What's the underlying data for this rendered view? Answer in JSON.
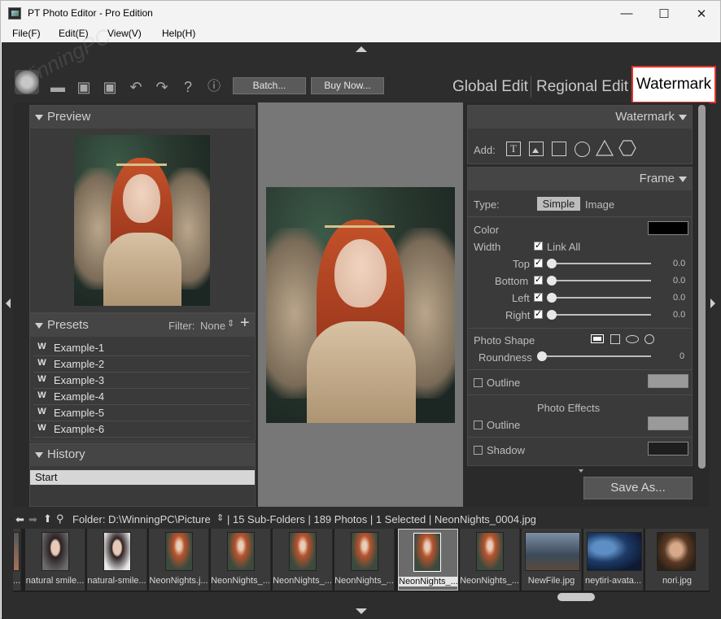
{
  "window": {
    "title": "PT Photo Editor - Pro Edition",
    "minimize": "—",
    "maximize": "☐",
    "close": "✕"
  },
  "menu": [
    "File(F)",
    "Edit(E)",
    "View(V)",
    "Help(H)"
  ],
  "toolbar": {
    "batch_label": "Batch...",
    "buy_label": "Buy Now..."
  },
  "mode_tabs": {
    "global": "Global Edit",
    "regional": "Regional Edit",
    "watermark": "Watermark"
  },
  "left": {
    "preview_title": "Preview",
    "presets_title": "Presets",
    "filter_label": "Filter:",
    "filter_value": "None",
    "presets": [
      "Example-1",
      "Example-2",
      "Example-3",
      "Example-4",
      "Example-5",
      "Example-6"
    ],
    "history_title": "History",
    "history_items": [
      "Start"
    ]
  },
  "right": {
    "watermark_title": "Watermark",
    "add_label": "Add:",
    "frame_title": "Frame",
    "type_label": "Type:",
    "type_simple": "Simple",
    "type_image": "Image",
    "color_label": "Color",
    "width_label": "Width",
    "link_all": "Link All",
    "sides": [
      {
        "label": "Top",
        "value": "0.0"
      },
      {
        "label": "Bottom",
        "value": "0.0"
      },
      {
        "label": "Left",
        "value": "0.0"
      },
      {
        "label": "Right",
        "value": "0.0"
      }
    ],
    "photo_shape_label": "Photo Shape",
    "roundness_label": "Roundness",
    "roundness_value": "0",
    "outline_label": "Outline",
    "photo_effects_label": "Photo Effects",
    "effects_outline_label": "Outline",
    "shadow_label": "Shadow",
    "save_as_label": "Save As...",
    "colors": {
      "frame_color": "#000000",
      "outline_color": "#9a9a9a",
      "effects_outline_color": "#9a9a9a",
      "shadow_color": "#1e1e1e"
    }
  },
  "browser": {
    "folder_label": "Folder:",
    "folder_path": "D:\\WinningPC\\Picture",
    "status": "| 15 Sub-Folders | 189 Photos | 1 Selected | NeonNights_0004.jpg"
  },
  "thumbnails": [
    {
      "caption": "..."
    },
    {
      "caption": "natural smile..."
    },
    {
      "caption": "natural-smile..."
    },
    {
      "caption": "NeonNights.j..."
    },
    {
      "caption": "NeonNights_..."
    },
    {
      "caption": "NeonNights_..."
    },
    {
      "caption": "NeonNights_..."
    },
    {
      "caption": "NeonNights_..."
    },
    {
      "caption": "NeonNights_..."
    },
    {
      "caption": "NewFile.jpg"
    },
    {
      "caption": "neytiri-avata..."
    },
    {
      "caption": "nori.jpg"
    }
  ],
  "watermark_text": "WinningPC"
}
